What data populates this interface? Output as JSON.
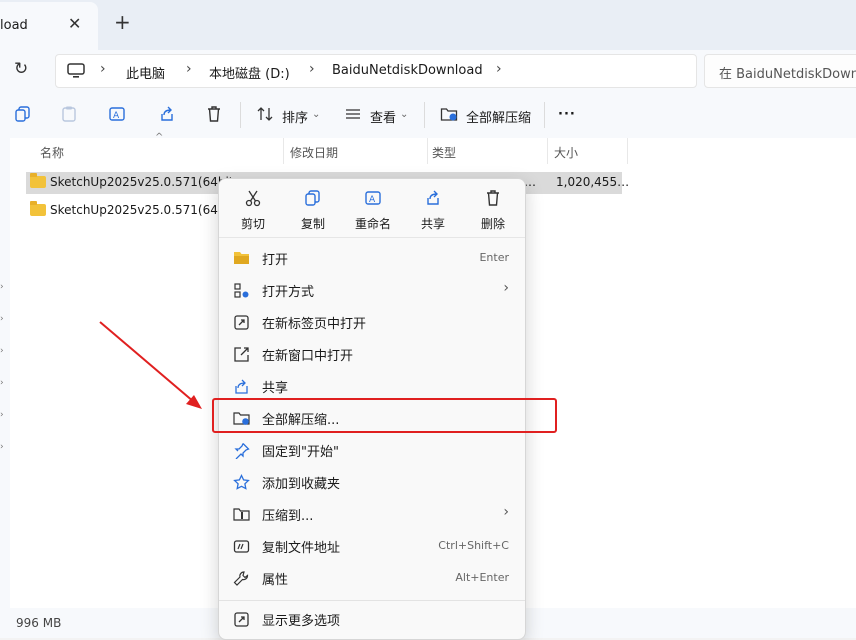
{
  "tab": {
    "title": "load",
    "close": "✕",
    "new": "+"
  },
  "address": {
    "crumbs": [
      "此电脑",
      "本地磁盘 (D:)",
      "BaiduNetdiskDownload"
    ],
    "sep": "›",
    "search_placeholder": "在 BaiduNetdiskDownl"
  },
  "toolbar": {
    "sort": "排序",
    "view": "查看",
    "extract_all": "全部解压缩",
    "more": "···"
  },
  "columns": {
    "name": "名称",
    "modified": "修改日期",
    "type": "类型",
    "size": "大小"
  },
  "files": [
    {
      "name": "SketchUp2025v25.0.571(64bit",
      "type": "…",
      "size": "1,020,455…"
    },
    {
      "name": "SketchUp2025v25.0.571(64bit",
      "type": "",
      "size": ""
    }
  ],
  "status": {
    "size": "996 MB"
  },
  "context_menu": {
    "quick_actions": [
      {
        "label": "剪切",
        "icon": "cut-icon"
      },
      {
        "label": "复制",
        "icon": "copy-icon"
      },
      {
        "label": "重命名",
        "icon": "rename-icon"
      },
      {
        "label": "共享",
        "icon": "share-icon"
      },
      {
        "label": "删除",
        "icon": "delete-icon"
      }
    ],
    "items": [
      {
        "label": "打开",
        "shortcut": "Enter"
      },
      {
        "label": "打开方式",
        "submenu": "›"
      },
      {
        "label": "在新标签页中打开"
      },
      {
        "label": "在新窗口中打开"
      },
      {
        "label": "共享"
      },
      {
        "label": "全部解压缩..."
      },
      {
        "label": "固定到\"开始\""
      },
      {
        "label": "添加到收藏夹"
      },
      {
        "label": "压缩到...",
        "submenu": "›"
      },
      {
        "label": "复制文件地址",
        "shortcut": "Ctrl+Shift+C"
      },
      {
        "label": "属性",
        "shortcut": "Alt+Enter"
      },
      {
        "label": "显示更多选项"
      }
    ]
  },
  "colors": {
    "highlight": "#e02020",
    "accent": "#2a6fdb",
    "selection": "#dadada"
  }
}
